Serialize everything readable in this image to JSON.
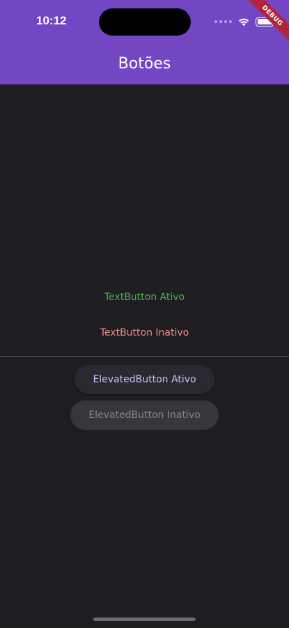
{
  "status_bar": {
    "time": "10:12",
    "icons": [
      "signal-dots-icon",
      "wifi-icon",
      "battery-icon"
    ]
  },
  "debug_banner": {
    "label": "DEBUG",
    "color": "#b3243c"
  },
  "app_bar": {
    "title": "Botões",
    "color": "#7347c4"
  },
  "buttons": {
    "text_active": {
      "label": "TextButton Ativo",
      "color": "#4ab84f"
    },
    "text_inactive": {
      "label": "TextButton Inativo",
      "color": "#f28b82"
    },
    "elevated_active": {
      "label": "ElevatedButton Ativo",
      "color": "#d0bcff"
    },
    "elevated_inactive": {
      "label": "ElevatedButton Inativo",
      "color": "#8a878c"
    }
  },
  "theme": {
    "background": "#1f1d21"
  }
}
